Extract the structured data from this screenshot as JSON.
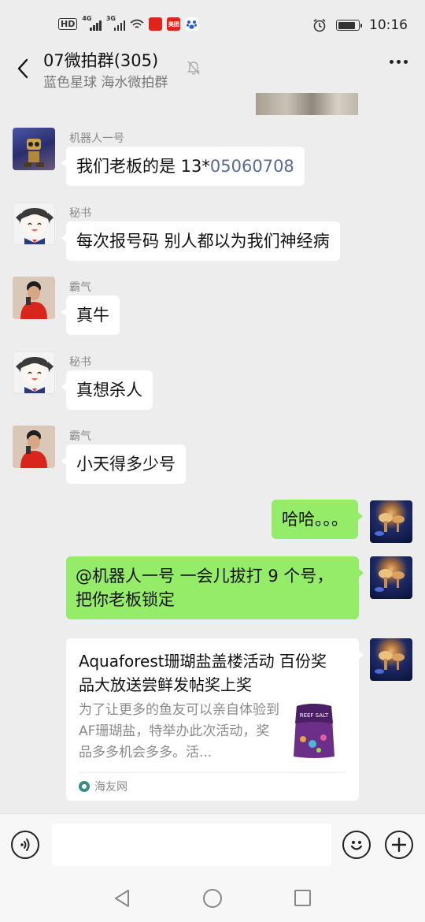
{
  "status_bar": {
    "network_labels": [
      "4G",
      "3G"
    ],
    "badges": [
      {
        "text": "",
        "color": "#e2231a"
      },
      {
        "text": "美团",
        "color": "#e2231a"
      }
    ],
    "time": "10:16",
    "battery_level": 0.85
  },
  "header": {
    "title": "07微拍群(305)",
    "subtitle": "蓝色星球 海水微拍群",
    "icons": {
      "back": "chevron-left-icon",
      "mute": "bell-muted-icon",
      "more": "more-dots-icon"
    }
  },
  "messages": [
    {
      "sender": "机器人一号",
      "text_prefix": "我们老板的是  13*",
      "text_link": "05060708"
    },
    {
      "sender": "秘书",
      "text": "每次报号码 别人都以为我们神经病"
    },
    {
      "sender": "霸气",
      "text": "真牛"
    },
    {
      "sender": "秘书",
      "text": "真想杀人"
    },
    {
      "sender": "霸气",
      "text": "小天得多少号"
    }
  ],
  "my_messages": [
    {
      "text": "哈哈。。。"
    },
    {
      "text_line1": "@机器人一号  一会儿拔打 9 个号，",
      "text_line2": "把你老板锁定"
    }
  ],
  "card": {
    "title": "Aquaforest珊瑚盐盖楼活动 百份奖品大放送尝鲜发帖奖上奖",
    "description": "为了让更多的鱼友可以亲自体验到AF珊瑚盐，特举办此次活动，奖品多多机会多多。活...",
    "source": "海友网",
    "thumb_text": "REEF SALT"
  },
  "colors": {
    "background": "#ededed",
    "my_bubble": "#95ec69",
    "other_bubble": "#ffffff",
    "link": "#576b95"
  }
}
